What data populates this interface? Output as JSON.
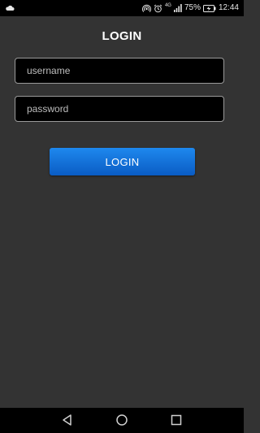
{
  "status_bar": {
    "battery_percent": "75%",
    "time": "12:44",
    "network_label": "4G",
    "icons": [
      "cloud-icon",
      "hotspot-icon",
      "alarm-icon",
      "signal-icon",
      "battery-charging-icon"
    ]
  },
  "login_screen": {
    "title": "LOGIN",
    "username_placeholder": "username",
    "password_placeholder": "password",
    "login_button_label": "LOGIN",
    "accent_color": "#1677e0"
  },
  "nav_bar": {
    "buttons": [
      "back-icon",
      "home-icon",
      "recents-icon"
    ]
  }
}
